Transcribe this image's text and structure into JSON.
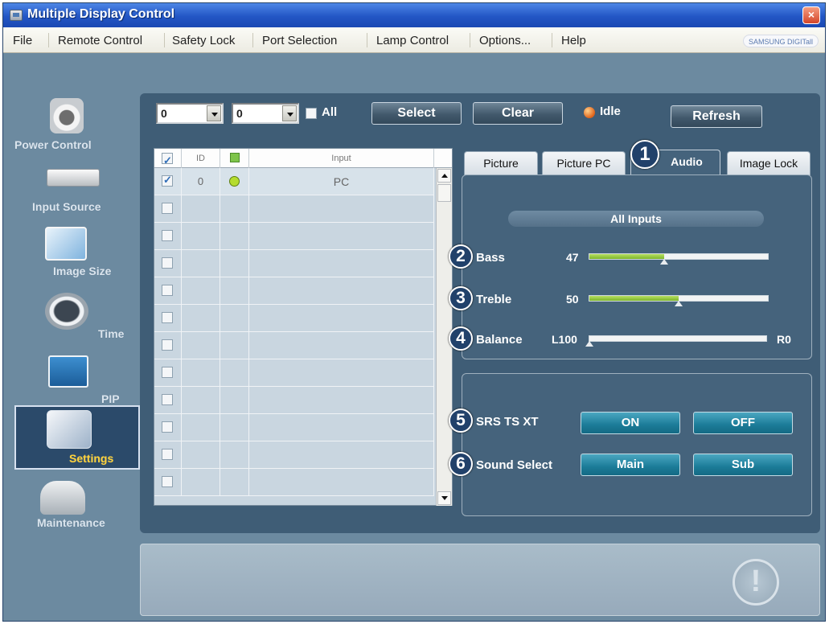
{
  "window": {
    "title": "Multiple Display Control",
    "close_label": "×",
    "brand": "SAMSUNG DIGITall"
  },
  "menu": [
    "File",
    "Remote Control",
    "Safety Lock",
    "Port Selection",
    "Lamp Control",
    "Options...",
    "Help"
  ],
  "sidebar": [
    {
      "label": "Power Control",
      "icon": "power-control-icon"
    },
    {
      "label": "Input Source",
      "icon": "input-source-icon"
    },
    {
      "label": "Image Size",
      "icon": "image-size-icon"
    },
    {
      "label": "Time",
      "icon": "time-icon"
    },
    {
      "label": "PIP",
      "icon": "pip-icon"
    },
    {
      "label": "Settings",
      "icon": "settings-icon",
      "selected": true
    },
    {
      "label": "Maintenance",
      "icon": "maintenance-icon"
    }
  ],
  "toolbar": {
    "combo1": "0",
    "combo2": "0",
    "all_label": "All",
    "select_label": "Select",
    "clear_label": "Clear",
    "refresh_label": "Refresh",
    "status": "Idle",
    "status_color": "#e06218"
  },
  "grid": {
    "headers": [
      "ID",
      "Input"
    ],
    "rows": [
      {
        "checked": true,
        "id": "0",
        "status_color": "#b5dc2e",
        "input": "PC"
      }
    ],
    "empty_rows": 11
  },
  "tabs": [
    "Picture",
    "Picture PC",
    "Audio",
    "Image Lock"
  ],
  "active_tab": "Audio",
  "audio": {
    "header": "All Inputs",
    "bass": {
      "label": "Bass",
      "value": "47",
      "level": 0.47
    },
    "treble": {
      "label": "Treble",
      "value": "50",
      "level": 0.5
    },
    "balance": {
      "label": "Balance",
      "left": "L100",
      "right": "R0",
      "level": 0.0
    },
    "srs": {
      "label": "SRS TS XT",
      "on": "ON",
      "off": "OFF"
    },
    "sound_select": {
      "label": "Sound Select",
      "main": "Main",
      "sub": "Sub"
    }
  },
  "callouts": [
    "1",
    "2",
    "3",
    "4",
    "5",
    "6"
  ],
  "accent_green": "#8cc63f",
  "button_teal": "#1b7b98"
}
